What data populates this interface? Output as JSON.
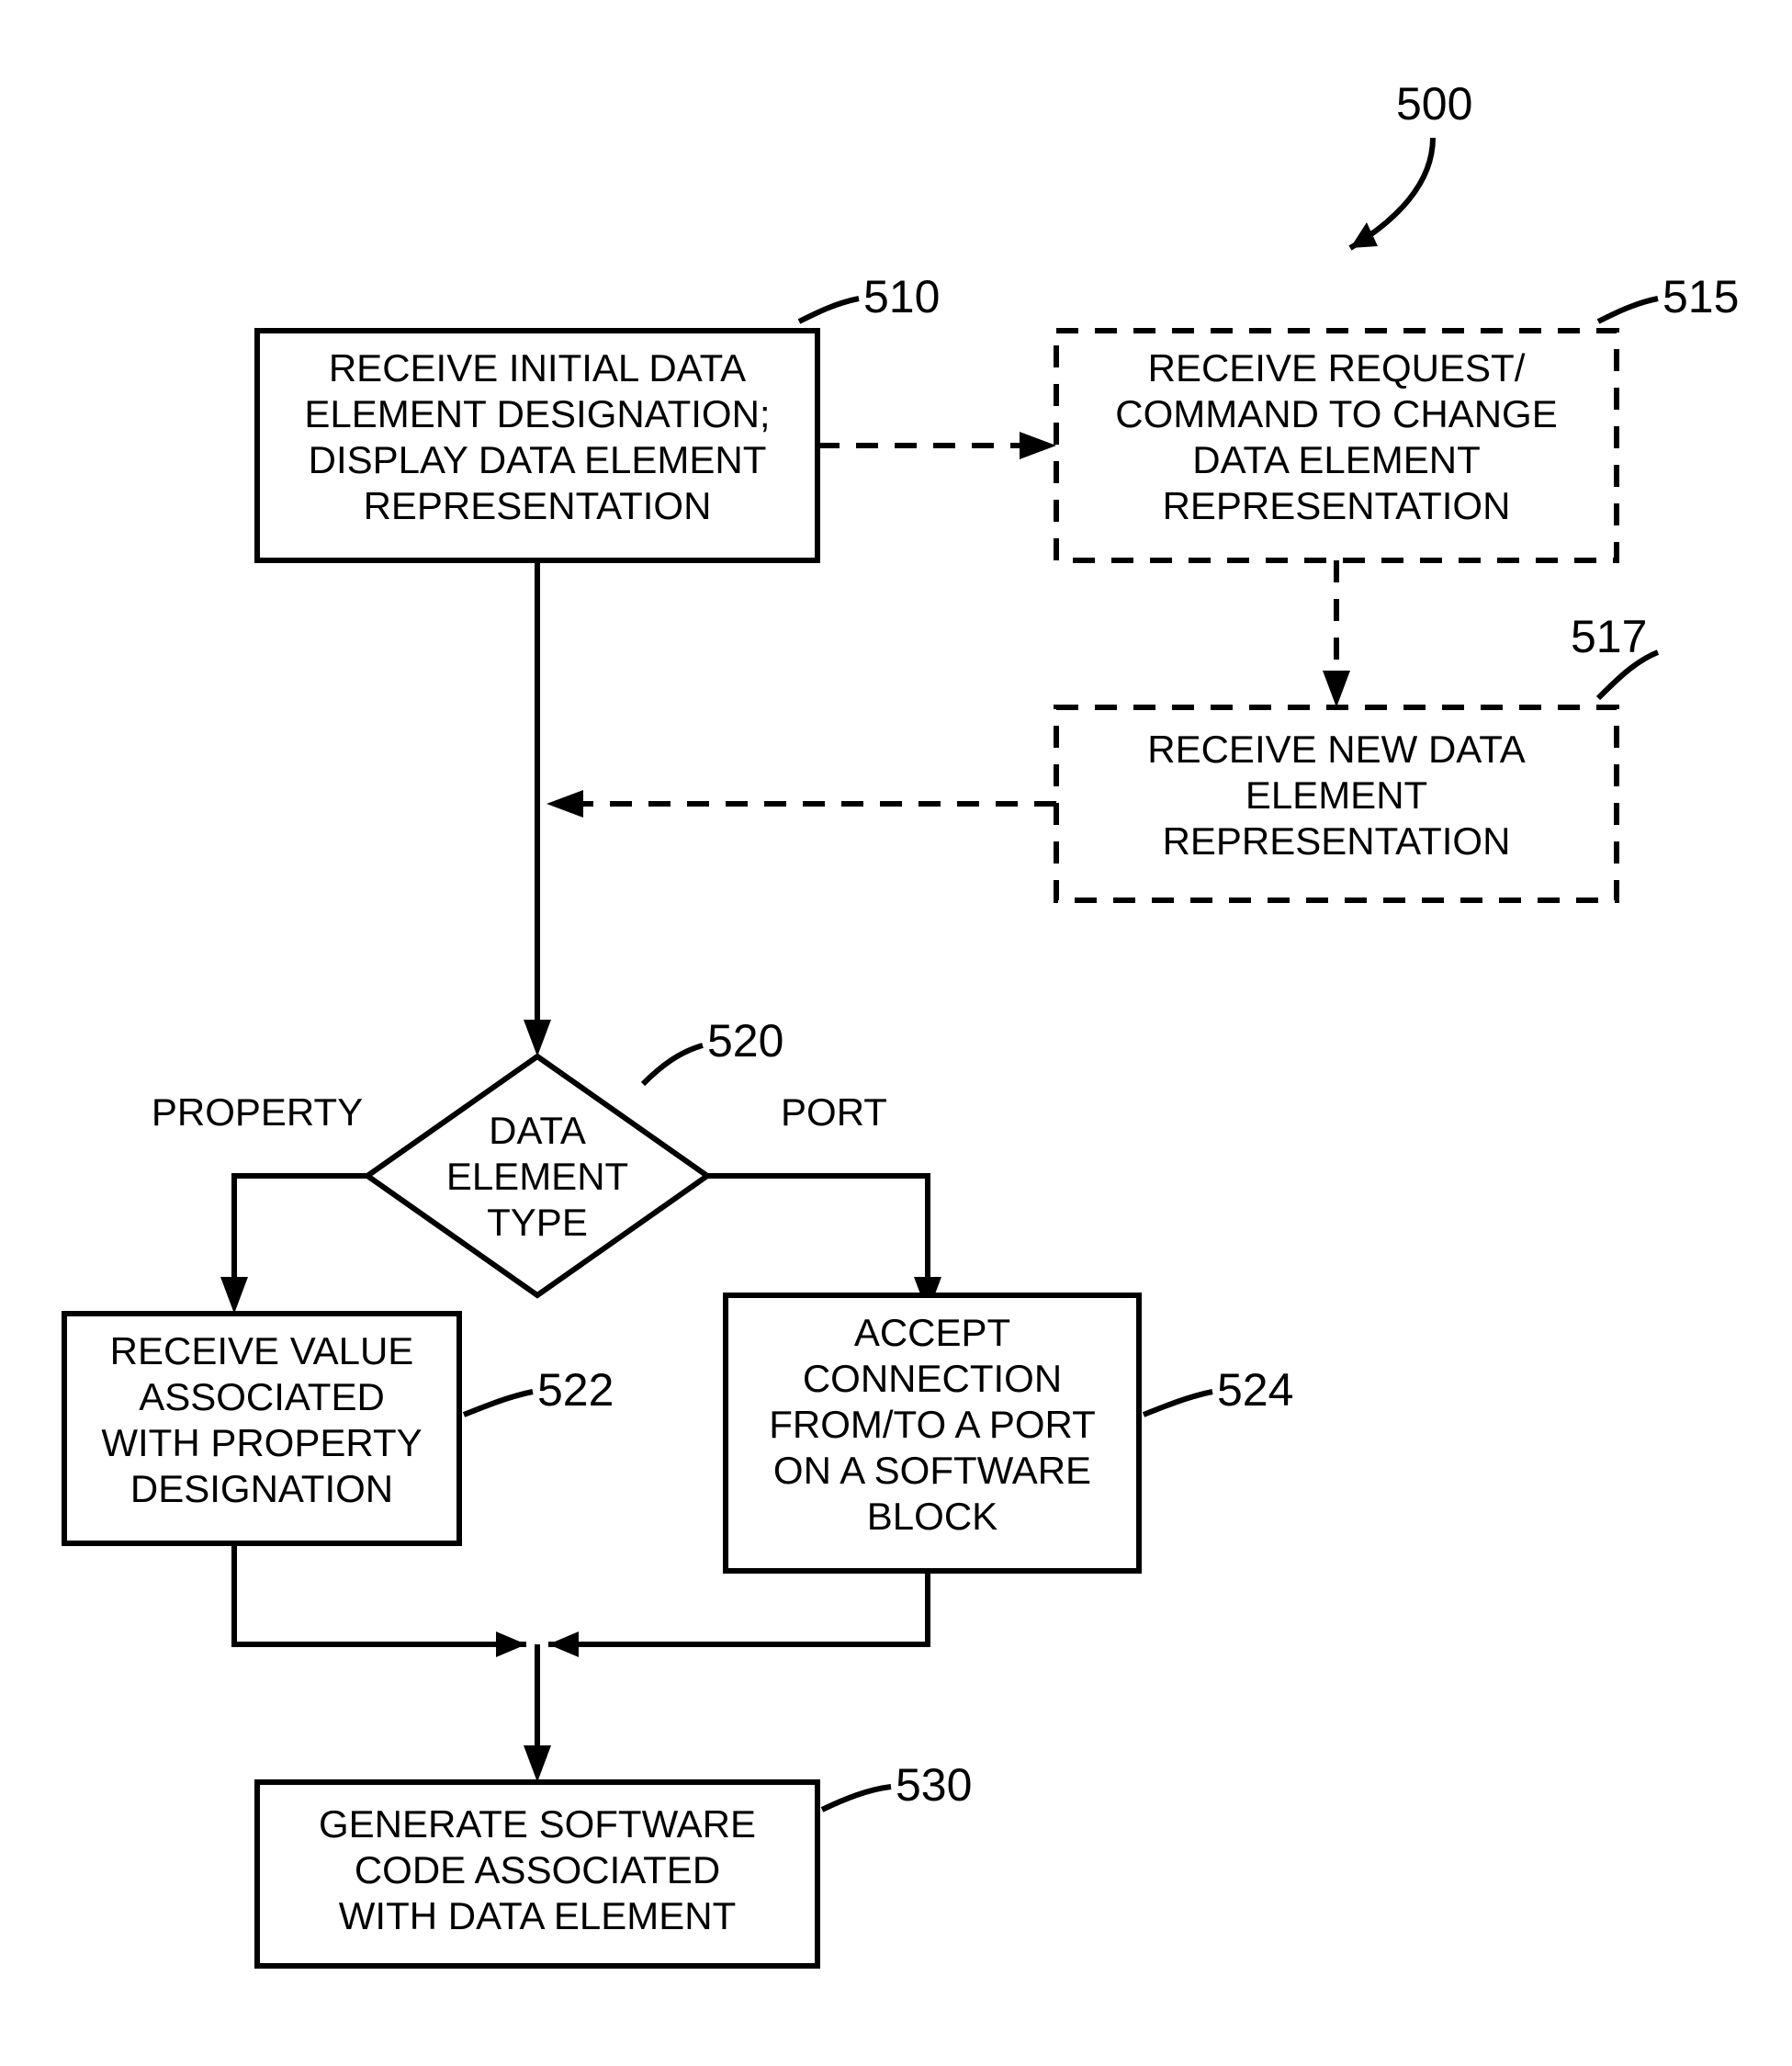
{
  "figure_ref": "500",
  "nodes": {
    "n510": {
      "ref": "510",
      "lines": [
        "RECEIVE INITIAL DATA",
        "ELEMENT DESIGNATION;",
        "DISPLAY DATA ELEMENT",
        "REPRESENTATION"
      ]
    },
    "n515": {
      "ref": "515",
      "lines": [
        "RECEIVE REQUEST/",
        "COMMAND TO CHANGE",
        "DATA ELEMENT",
        "REPRESENTATION"
      ]
    },
    "n517": {
      "ref": "517",
      "lines": [
        "RECEIVE NEW DATA",
        "ELEMENT",
        "REPRESENTATION"
      ]
    },
    "n520": {
      "ref": "520",
      "lines": [
        "DATA",
        "ELEMENT",
        "TYPE"
      ]
    },
    "n522": {
      "ref": "522",
      "lines": [
        "RECEIVE VALUE",
        "ASSOCIATED",
        "WITH PROPERTY",
        "DESIGNATION"
      ]
    },
    "n524": {
      "ref": "524",
      "lines": [
        "ACCEPT",
        "CONNECTION",
        "FROM/TO A PORT",
        "ON A SOFTWARE",
        "BLOCK"
      ]
    },
    "n530": {
      "ref": "530",
      "lines": [
        "GENERATE SOFTWARE",
        "CODE ASSOCIATED",
        "WITH DATA ELEMENT"
      ]
    }
  },
  "branches": {
    "left": "PROPERTY",
    "right": "PORT"
  }
}
